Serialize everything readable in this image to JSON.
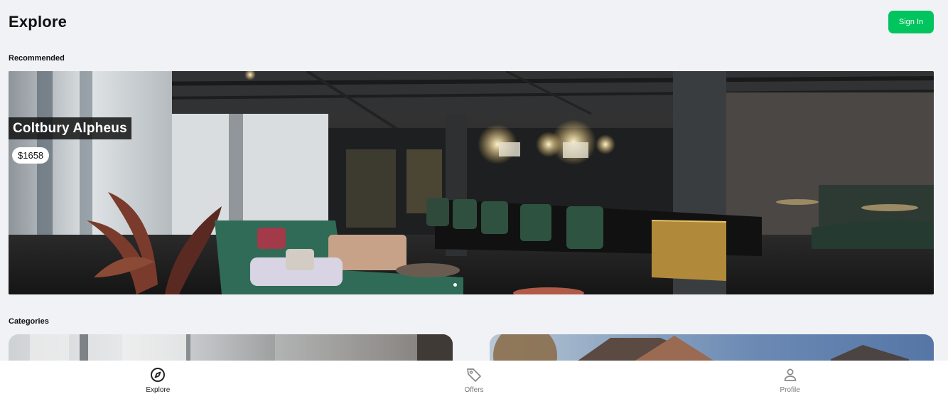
{
  "header": {
    "title": "Explore",
    "signin_label": "Sign In"
  },
  "sections": {
    "recommended": "Recommended",
    "categories": "Categories"
  },
  "hero": {
    "name": "Coltbury Alpheus",
    "price": "$1658",
    "image": "hotel-lounge-bar-interior"
  },
  "categories": [
    {
      "image": "modern-interior-room"
    },
    {
      "image": "house-exterior"
    }
  ],
  "nav": {
    "items": [
      {
        "label": "Explore",
        "icon": "compass-icon",
        "active": true
      },
      {
        "label": "Offers",
        "icon": "tag-icon",
        "active": false
      },
      {
        "label": "Profile",
        "icon": "person-icon",
        "active": false
      }
    ]
  },
  "colors": {
    "accent": "#00c45e",
    "background": "#f1f2f6"
  }
}
